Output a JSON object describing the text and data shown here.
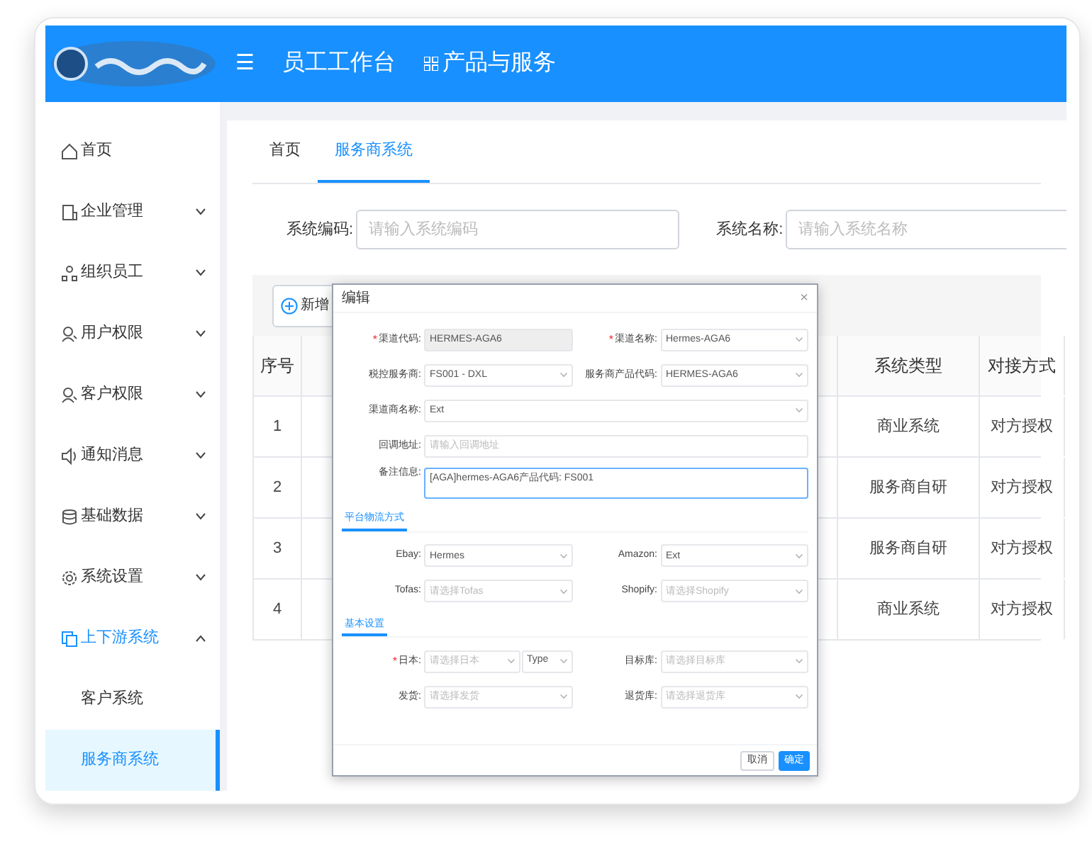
{
  "header": {
    "menu_icon": "☰",
    "nav": [
      {
        "label": "员工工作台"
      },
      {
        "label": "产品与服务",
        "icon": true
      }
    ]
  },
  "sidebar": {
    "items": [
      {
        "label": "首页",
        "selected": false
      },
      {
        "label": "企业管理",
        "expanded": false,
        "selected": false
      },
      {
        "label": "组织员工",
        "expanded": false,
        "selected": false
      },
      {
        "label": "用户权限",
        "expanded": false,
        "selected": false
      },
      {
        "label": "客户权限",
        "expanded": false,
        "selected": false
      },
      {
        "label": "通知消息",
        "expanded": false,
        "selected": false
      },
      {
        "label": "基础数据",
        "expanded": false,
        "selected": false
      },
      {
        "label": "系统设置",
        "expanded": false,
        "selected": false
      },
      {
        "label": "上下游系统",
        "expanded": true,
        "selected": false,
        "children": [
          {
            "label": "客户系统",
            "selected": false
          },
          {
            "label": "服务商系统",
            "selected": true
          }
        ]
      }
    ]
  },
  "tabs": [
    {
      "label": "首页",
      "selected": false
    },
    {
      "label": "服务商系统",
      "selected": true
    }
  ],
  "search": [
    {
      "label": "系统编码:",
      "placeholder": "请输入系统编码"
    },
    {
      "label": "系统名称:",
      "placeholder": "请输入系统名称"
    }
  ],
  "toolbar": {
    "add_button": "新增"
  },
  "table": {
    "columns": [
      "序号",
      "",
      "系统类型",
      "对接方式"
    ],
    "rows": [
      [
        "1",
        "",
        "商业系统",
        "对方授权"
      ],
      [
        "2",
        "",
        "服务商自研",
        "对方授权"
      ],
      [
        "3",
        "",
        "服务商自研",
        "对方授权"
      ],
      [
        "4",
        "",
        "商业系统",
        "对方授权"
      ]
    ]
  },
  "dialog": {
    "title": "编辑",
    "close": "×",
    "sections": [
      {
        "rows": [
          [
            {
              "mark": "*",
              "label": "渠道代码:",
              "kind": "input",
              "value": "HERMES-AGA6",
              "disabled": true
            },
            {
              "mark": "*",
              "label": "渠道名称:",
              "kind": "select",
              "value": "Hermes-AGA6"
            }
          ],
          [
            {
              "label": "税控服务商:",
              "kind": "select",
              "value": "FS001 - DXL"
            },
            {
              "label": "服务商产品代码:",
              "kind": "select",
              "value": "HERMES-AGA6"
            }
          ],
          [
            {
              "label": "渠道商名称:",
              "kind": "select",
              "value": "Ext"
            }
          ],
          [
            {
              "label": "回调地址:",
              "kind": "input",
              "placeholder": "请输入回调地址"
            }
          ],
          [
            {
              "label": "备注信息:",
              "kind": "textarea",
              "value": "[AGA]hermes-AGA6产品代码: FS001"
            }
          ]
        ]
      },
      {
        "title": "平台物流方式",
        "rows": [
          [
            {
              "label": "Ebay:",
              "kind": "select",
              "value": "Hermes"
            },
            {
              "label": "Amazon:",
              "kind": "select",
              "value": "Ext"
            }
          ],
          [
            {
              "label": "Tofas:",
              "kind": "select",
              "placeholder": "请选择Tofas"
            },
            {
              "label": "Shopify:",
              "kind": "select",
              "placeholder": "请选择Shopify"
            }
          ]
        ]
      },
      {
        "title": "基本设置",
        "rows": [
          [
            {
              "mark": "*",
              "label": "日本:",
              "kind": "select",
              "placeholder": "请选择日本",
              "addon": "Type"
            },
            {
              "label": "目标库:",
              "kind": "select",
              "placeholder": "请选择目标库"
            }
          ],
          [
            {
              "label": "发货:",
              "kind": "select",
              "placeholder": "请选择发货"
            },
            {
              "label": "退货库:",
              "kind": "select",
              "placeholder": "请选择退货库"
            }
          ]
        ]
      }
    ],
    "buttons": [
      {
        "label": "取消",
        "primary": false
      },
      {
        "label": "确定",
        "primary": true
      }
    ]
  }
}
